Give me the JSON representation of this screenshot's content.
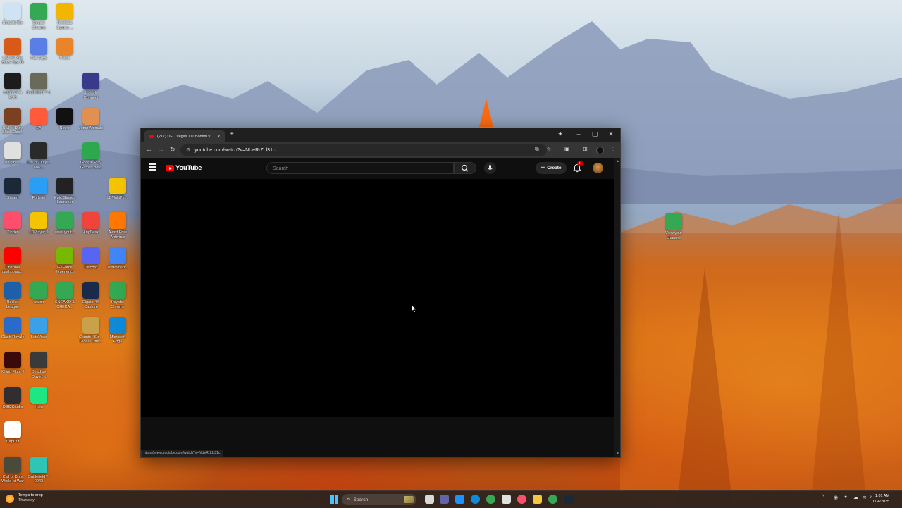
{
  "desktop": {
    "icons": [
      {
        "label": "Recycle Bin",
        "icon": "recycle-bin-icon",
        "color": "#cfe3f5"
      },
      {
        "label": "Google Chrome",
        "icon": "chrome-icon",
        "color": "#34a853"
      },
      {
        "label": "Rockstar Games ...",
        "icon": "rockstar-icon",
        "color": "#f2b600"
      },
      {
        "label": "Call of Duty Black Ops III",
        "icon": "cod-icon",
        "color": "#d85a18"
      },
      {
        "label": "Fall Guys",
        "icon": "fall-guys-icon",
        "color": "#5a7de6"
      },
      {
        "label": "Pixelfi",
        "icon": "pixelfi-icon",
        "color": "#e8842a"
      },
      {
        "label": "Logitech G HUB",
        "icon": "logitech-icon",
        "color": "#1c1c1c"
      },
      {
        "label": "Battlefield™ 6",
        "icon": "battlefield-icon",
        "color": "#6a6a5a"
      },
      {
        "label": "Ubisoft Connect",
        "icon": "ubisoft-icon",
        "color": "#3a3a8a"
      },
      {
        "label": "Call of Duty Black Ops...",
        "icon": "cod-icon",
        "color": "#7a4020"
      },
      {
        "label": "EA",
        "icon": "ea-icon",
        "color": "#ff5a3a"
      },
      {
        "label": "Netflix",
        "icon": "netflix-icon",
        "color": "#111111"
      },
      {
        "label": "Jump Animals",
        "icon": "game-icon",
        "color": "#e09050"
      },
      {
        "label": "Unigine...",
        "icon": "app-icon",
        "color": "#e0e0e0"
      },
      {
        "label": "Call of Duty®: MW...",
        "icon": "cod-mw-icon",
        "color": "#2a2a2a"
      },
      {
        "label": "Google Play Games beta",
        "icon": "play-games-icon",
        "color": "#2ea84f"
      },
      {
        "label": "Steam",
        "icon": "steam-icon",
        "color": "#1b2838"
      },
      {
        "label": "Fortnite",
        "icon": "fortnite-icon",
        "color": "#2a9df4"
      },
      {
        "label": "Epic Games Launcher",
        "icon": "epic-icon",
        "color": "#222222"
      },
      {
        "label": "LDMultiPla...",
        "icon": "ldplayer-icon",
        "color": "#f5c400"
      },
      {
        "label": "Tinder",
        "icon": "tinder-icon",
        "color": "#fd4f6c"
      },
      {
        "label": "LDPlayer 9",
        "icon": "ldplayer-icon",
        "color": "#f5c400"
      },
      {
        "label": "www.yout...",
        "icon": "chrome-icon",
        "color": "#34a853"
      },
      {
        "label": "AnyDesk",
        "icon": "anydesk-icon",
        "color": "#ef443b"
      },
      {
        "label": "Avast Free Antivirus",
        "icon": "avast-icon",
        "color": "#ff7800"
      },
      {
        "label": "Channel dashboard...",
        "icon": "youtube-icon",
        "color": "#ff0000"
      },
      {
        "label": "GeForce Experience",
        "icon": "nvidia-icon",
        "color": "#76b900"
      },
      {
        "label": "Discord",
        "icon": "discord-icon",
        "color": "#5865f2"
      },
      {
        "label": "Download...",
        "icon": "download-icon",
        "color": "#4285f4"
      },
      {
        "label": "Rocket League",
        "icon": "rocket-league-icon",
        "color": "#1d5fa8"
      },
      {
        "label": "watch",
        "icon": "chrome-icon",
        "color": "#34a853"
      },
      {
        "label": "SNEAKO & CHEKA...",
        "icon": "chrome-icon",
        "color": "#34a853"
      },
      {
        "label": "Elgato 4K Capture",
        "icon": "elgato-icon",
        "color": "#1a2a4a"
      },
      {
        "label": "Psyche Chrome",
        "icon": "chrome-icon",
        "color": "#34a853"
      },
      {
        "label": "Clash Royale",
        "icon": "clash-icon",
        "color": "#2a6ac8"
      },
      {
        "label": "LetsView",
        "icon": "letsview-icon",
        "color": "#3aa0e8"
      },
      {
        "label": "Counter-Stri... Global Offe...",
        "icon": "csgo-icon",
        "color": "#c8a24a"
      },
      {
        "label": "Microsoft Edge",
        "icon": "edge-icon",
        "color": "#0f8ad8"
      },
      {
        "label": "Killing Floor 2",
        "icon": "killing-floor-icon",
        "color": "#3a0a0a"
      },
      {
        "label": "Dead by Daylight",
        "icon": "dbd-icon",
        "color": "#3a3a3a"
      },
      {
        "label": "OBS Studio",
        "icon": "obs-icon",
        "color": "#302e31"
      },
      {
        "label": "Hulu",
        "icon": "hulu-icon",
        "color": "#1ce783"
      },
      {
        "label": "CapCut",
        "icon": "capcut-icon",
        "color": "#ffffff"
      },
      {
        "label": "Call of Duty World at War",
        "icon": "cod-icon",
        "color": "#4a4a3a"
      },
      {
        "label": "Battlefield™ 2042",
        "icon": "battlefield-icon",
        "color": "#2ec4b6"
      },
      {
        "label": "View your channel",
        "icon": "chrome-icon",
        "color": "#34a853"
      }
    ]
  },
  "browser": {
    "tab_title": "(217) UFC Vegas 111 Bonfim v...",
    "tab_close": "×",
    "new_tab": "+",
    "url": "youtube.com/watch?v=NUeRrZLl31c",
    "status_url": "https://www.youtube.com/watch?v=NUeRrZLl31c",
    "youtube": {
      "logo_text": "YouTube",
      "search_placeholder": "Search",
      "create_label": "Create",
      "notification_badge": "9+"
    }
  },
  "taskbar": {
    "weather_line1": "Temps to drop",
    "weather_line2": "Thursday",
    "search_label": "Search",
    "time": "1:01 AM",
    "date": "11/4/2025"
  }
}
